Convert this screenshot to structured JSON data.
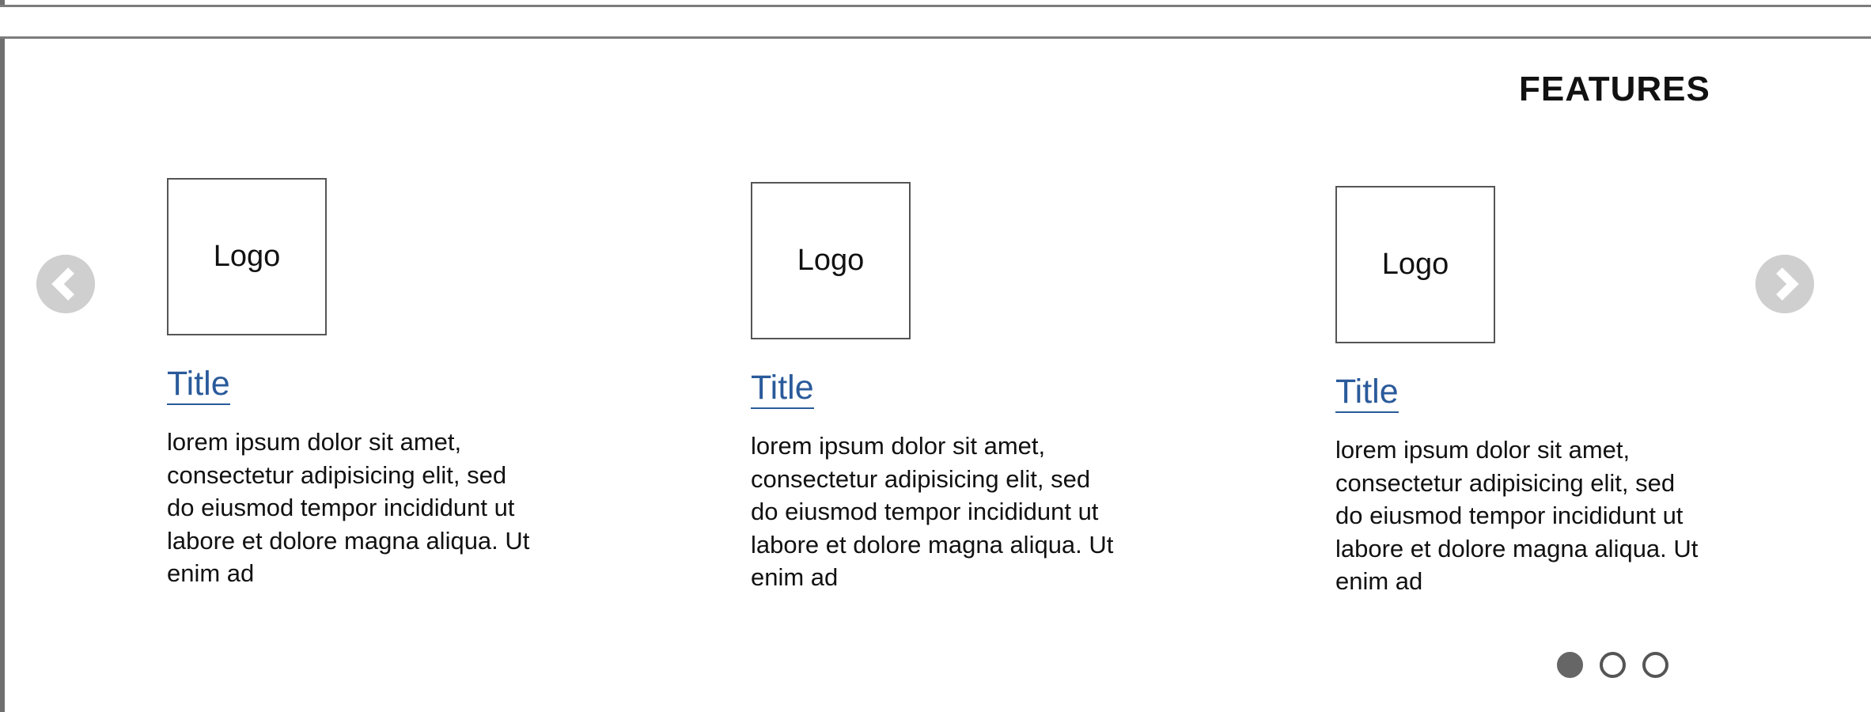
{
  "section": {
    "heading": "FEATURES"
  },
  "carousel": {
    "prev_icon": "chevron-left-icon",
    "next_icon": "chevron-right-icon",
    "arrow_color": "#cfcfcf",
    "features": [
      {
        "logo_label": "Logo",
        "title": "Title",
        "body": "lorem ipsum dolor sit amet, consectetur adipisicing elit, sed do eiusmod tempor incididunt ut labore et dolore magna aliqua. Ut enim ad"
      },
      {
        "logo_label": "Logo",
        "title": "Title",
        "body": "lorem ipsum dolor sit amet, consectetur adipisicing elit, sed do eiusmod tempor incididunt ut labore et dolore magna aliqua. Ut enim ad"
      },
      {
        "logo_label": "Logo",
        "title": "Title",
        "body": "lorem ipsum dolor sit amet, consectetur adipisicing elit, sed do eiusmod tempor incididunt ut labore et dolore magna aliqua. Ut enim ad"
      }
    ],
    "pagination": {
      "total": 3,
      "active_index": 0
    }
  },
  "colors": {
    "title_link": "#2a5a9a",
    "frame": "#7c7c7c"
  }
}
